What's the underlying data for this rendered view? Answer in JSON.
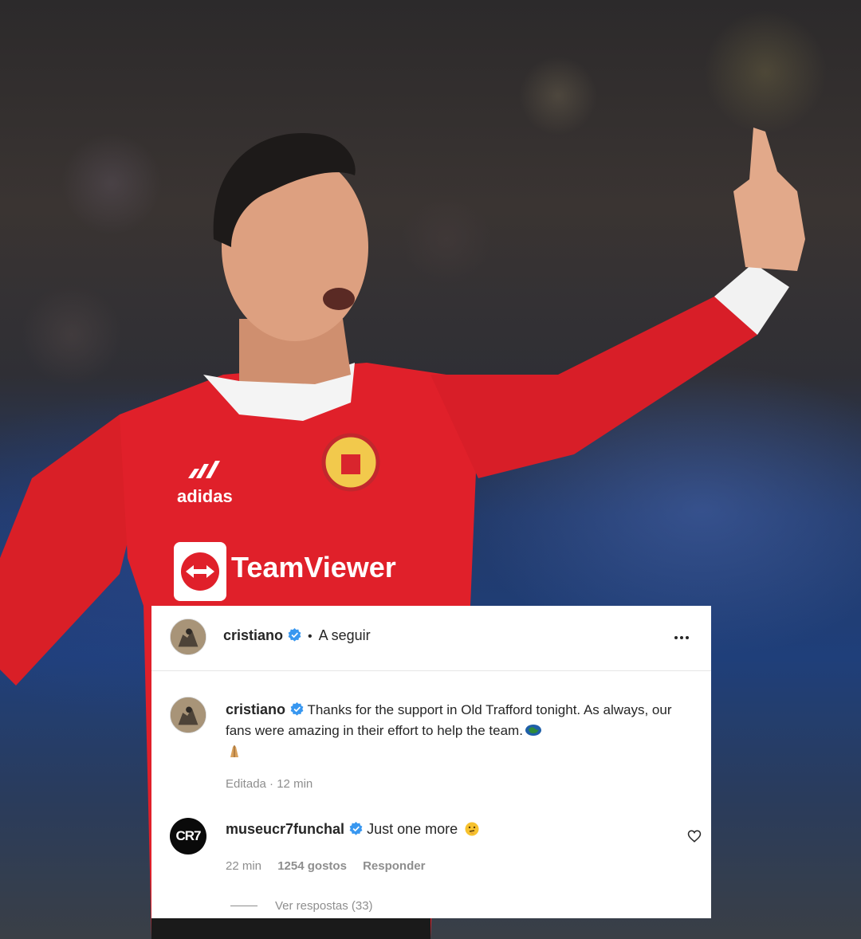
{
  "post": {
    "author": "cristiano",
    "follow_state": "A seguir",
    "separator": "•",
    "caption_author": "cristiano",
    "caption": "Thanks for the support in Old Trafford tonight. As always, our fans were amazing in their effort to help the team.",
    "caption_emojis": [
      "earth-emoji",
      "praying-hands-emoji"
    ],
    "edited_label": "Editada",
    "edited_separator": "·",
    "time_ago": "12 min"
  },
  "comment": {
    "author": "museucr7funchal",
    "avatar_text": "CR7",
    "text": "Just one more",
    "emoji": "thinking-face-emoji",
    "time_ago": "22 min",
    "likes": "1254 gostos",
    "reply_label": "Responder",
    "view_replies": "Ver respostas (33)"
  },
  "photo": {
    "jersey_brand": "adidas",
    "sponsor": "TeamViewer",
    "jersey_color": "#e0202a"
  },
  "colors": {
    "verified_blue": "#3897f0",
    "text": "#262626",
    "muted": "#8e8e8e"
  }
}
